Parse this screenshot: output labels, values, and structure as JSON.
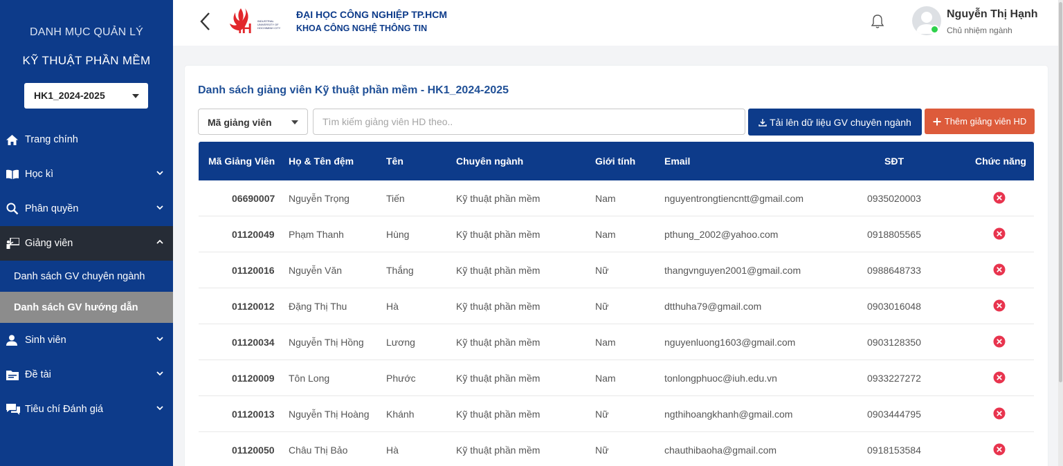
{
  "sidebar": {
    "title_line1": "DANH MỤC QUẢN LÝ",
    "title_line2": "KỸ THUẬT PHẦN MỀM",
    "semester": "HK1_2024-2025",
    "items": [
      {
        "label": "Trang chính",
        "icon": "home-icon"
      },
      {
        "label": "Học kì",
        "icon": "book-icon"
      },
      {
        "label": "Phân quyền",
        "icon": "search-icon"
      },
      {
        "label": "Giảng viên",
        "icon": "teacher-icon"
      },
      {
        "label": "Sinh viên",
        "icon": "user-icon"
      },
      {
        "label": "Đề tài",
        "icon": "folder-icon"
      },
      {
        "label": "Tiêu chí Đánh giá",
        "icon": "comment-icon"
      }
    ],
    "sub_items": [
      {
        "label": "Danh sách GV chuyên ngành"
      },
      {
        "label": "Danh sách GV hướng dẫn"
      }
    ]
  },
  "header": {
    "university": "ĐẠI HỌC CÔNG NGHIỆP TP.HCM",
    "faculty": "KHOA CÔNG NGHỆ THÔNG TIN",
    "logo_text": "INDUSTRIAL UNIVERSITY OF HOCHIMINH CITY",
    "user_name": "Nguyễn Thị Hạnh",
    "user_role": "Chủ nhiệm ngành"
  },
  "main": {
    "title": "Danh sách giảng viên Kỹ thuật phần mềm - HK1_2024-2025",
    "filter_value": "Mã giảng viên",
    "search_placeholder": "Tìm kiếm giảng viên HD theo..",
    "upload_button": "Tải lên dữ liệu GV chuyên ngành",
    "add_button": "Thêm giảng viên HD",
    "columns": [
      "Mã Giảng Viên",
      "Họ & Tên đệm",
      "Tên",
      "Chuyên ngành",
      "Giới tính",
      "Email",
      "SĐT",
      "Chức năng"
    ],
    "rows": [
      {
        "id": "06690007",
        "last": "Nguyễn Trọng",
        "first": "Tiến",
        "major": "Kỹ thuật phần mềm",
        "gender": "Nam",
        "email": "nguyentrongtiencntt@gmail.com",
        "phone": "0935020003"
      },
      {
        "id": "01120049",
        "last": "Phạm Thanh",
        "first": "Hùng",
        "major": "Kỹ thuật phần mềm",
        "gender": "Nam",
        "email": "pthung_2002@yahoo.com",
        "phone": "0918805565"
      },
      {
        "id": "01120016",
        "last": "Nguyễn Văn",
        "first": "Thắng",
        "major": "Kỹ thuật phần mềm",
        "gender": "Nữ",
        "email": "thangvnguyen2001@gmail.com",
        "phone": "0988648733"
      },
      {
        "id": "01120012",
        "last": "Đặng Thị Thu",
        "first": "Hà",
        "major": "Kỹ thuật phần mềm",
        "gender": "Nữ",
        "email": "dtthuha79@gmail.com",
        "phone": "0903016048"
      },
      {
        "id": "01120034",
        "last": "Nguyễn Thị Hồng",
        "first": "Lương",
        "major": "Kỹ thuật phần mềm",
        "gender": "Nam",
        "email": "nguyenluong1603@gmail.com",
        "phone": "0903128350"
      },
      {
        "id": "01120009",
        "last": "Tôn Long",
        "first": "Phước",
        "major": "Kỹ thuật phần mềm",
        "gender": "Nam",
        "email": "tonlongphuoc@iuh.edu.vn",
        "phone": "0933227272"
      },
      {
        "id": "01120013",
        "last": "Nguyễn Thị Hoàng",
        "first": "Khánh",
        "major": "Kỹ thuật phần mềm",
        "gender": "Nữ",
        "email": "ngthihoangkhanh@gmail.com",
        "phone": "0903444795"
      },
      {
        "id": "01120050",
        "last": "Châu Thị Bảo",
        "first": "Hà",
        "major": "Kỹ thuật phần mềm",
        "gender": "Nữ",
        "email": "chauthibaoha@gmail.com",
        "phone": "0918153584"
      }
    ]
  },
  "colors": {
    "primary": "#0d3b8a",
    "accent": "#dd5b3b",
    "delete": "#e8344e",
    "online": "#2ed14b"
  }
}
